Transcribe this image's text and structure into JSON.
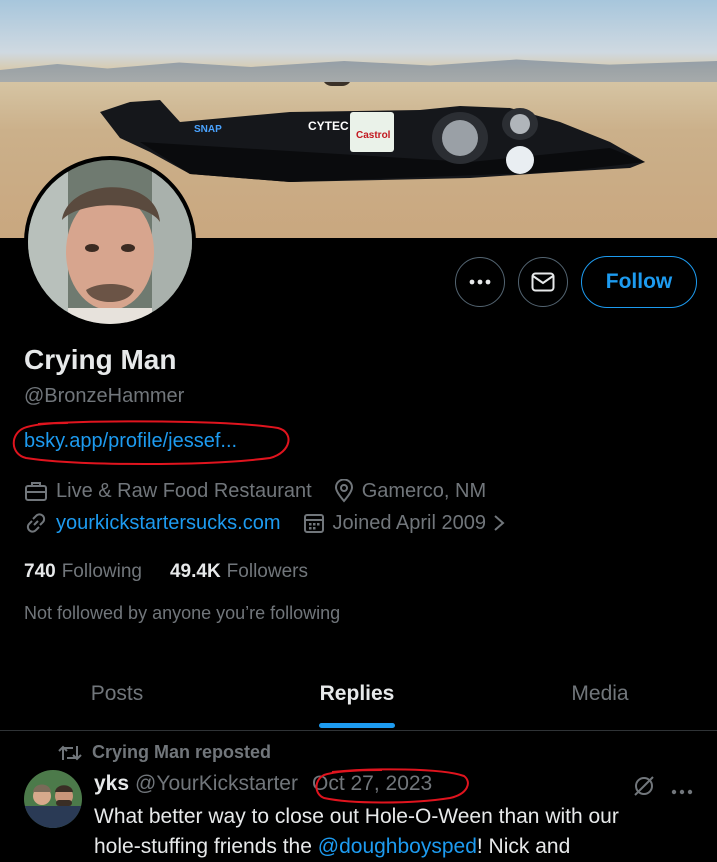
{
  "profile": {
    "display_name": "Crying Man",
    "handle": "@BronzeHammer",
    "bio_link": "bsky.app/profile/jessef...",
    "category": "Live & Raw Food Restaurant",
    "location": "Gamerco, NM",
    "website": "yourkickstartersucks.com",
    "joined": "Joined April 2009",
    "following_count": "740",
    "following_label": "Following",
    "followers_count": "49.4K",
    "followers_label": "Followers",
    "not_followed_text": "Not followed by anyone you’re following"
  },
  "actions": {
    "follow_label": "Follow"
  },
  "tabs": [
    {
      "label": "Posts",
      "active": false
    },
    {
      "label": "Replies",
      "active": true
    },
    {
      "label": "Media",
      "active": false
    }
  ],
  "tweet": {
    "repost_text": "Crying Man reposted",
    "author_name": "yks",
    "author_handle": "@YourKickstarter",
    "date": "Oct 27, 2023",
    "text_start": "What better way to close out Hole-O-Ween than with our",
    "text_line2": "hole-stuffing friends the ",
    "mention": "@doughboysped",
    "text_end": "! Nick and"
  },
  "banner": {
    "car_labels": [
      "CYTEC",
      "Castrol",
      "SNAP"
    ]
  },
  "colors": {
    "accent": "#1d9bf0",
    "annotation": "#e0141e",
    "background": "#000000",
    "muted": "#71767b"
  },
  "icons": [
    "more-icon",
    "message-icon",
    "briefcase-icon",
    "location-icon",
    "link-icon",
    "calendar-icon",
    "chevron-right-icon",
    "repost-icon",
    "grok-icon"
  ]
}
